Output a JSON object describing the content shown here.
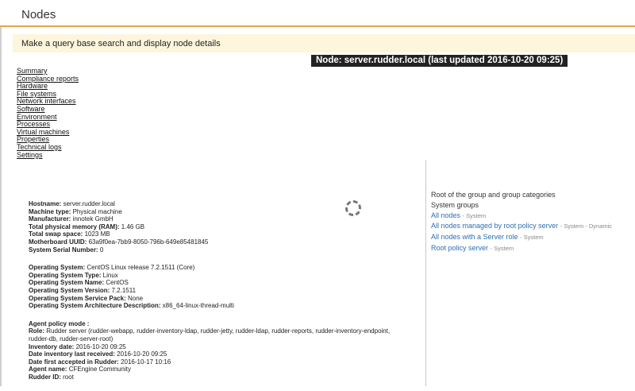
{
  "header": {
    "title": "Nodes"
  },
  "query_bar": {
    "text": "Make a query base search and display node details"
  },
  "node_title": "Node: server.rudder.local (last updated 2016-10-20 09:25)",
  "nav": [
    "Summary",
    "Compliance reports",
    "Hardware",
    "File systems",
    "Network interfaces",
    "Software",
    "Environment",
    "Processes",
    "Virtual machines",
    "Properties",
    "Technical logs",
    "Settings"
  ],
  "machine": {
    "hostname_label": "Hostname:",
    "hostname": "server.rudder.local",
    "machine_type_label": "Machine type:",
    "machine_type": "Physical machine",
    "manufacturer_label": "Manufacturer:",
    "manufacturer": "innotek GmbH",
    "memory_label": "Total physical memory (RAM):",
    "memory": "1.46 GB",
    "swap_label": "Total swap space:",
    "swap": "1023 MB",
    "uuid_label": "Motherboard UUID:",
    "uuid": "63a9f0ea-7bb9-8050-796b-649e85481845",
    "serial_label": "System Serial Number:",
    "serial": "0"
  },
  "os": {
    "os_label": "Operating System:",
    "os": "CentOS Linux release 7.2.1511 (Core)",
    "type_label": "Operating System Type:",
    "type": "Linux",
    "name_label": "Operating System Name:",
    "name": "CentOS",
    "version_label": "Operating System Version:",
    "version": "7.2.1511",
    "sp_label": "Operating System Service Pack:",
    "sp": "None",
    "arch_label": "Operating System Architecture Description:",
    "arch": "x86_64-linux-thread-multi"
  },
  "agent": {
    "policy_mode_label": "Agent policy mode :",
    "role_label": "Role:",
    "role": "Rudder server (rudder-webapp, rudder-inventory-ldap, rudder-jetty, rudder-ldap, rudder-reports, rudder-inventory-endpoint, rudder-db, rudder-server-root)",
    "inventory_date_label": "Inventory date:",
    "inventory_date": "2016-10-20 09:25",
    "last_received_label": "Date inventory last received:",
    "last_received": "2016-10-20 09:25",
    "first_accepted_label": "Date first accepted in Rudder:",
    "first_accepted": "2016-10-17 10:16",
    "agent_name_label": "Agent name:",
    "agent_name": "CFEngine Community",
    "rudder_id_label": "Rudder ID:",
    "rudder_id": "root"
  },
  "groups": {
    "root": "Root of the group and group categories",
    "system_groups": "System groups",
    "items": [
      {
        "name": "All nodes",
        "tag": "- System"
      },
      {
        "name": "All nodes managed by root policy server",
        "tag": "- System - Dynamic"
      },
      {
        "name": "All nodes with a Server role",
        "tag": "- System"
      },
      {
        "name": "Root policy server",
        "tag": "- System"
      }
    ]
  }
}
